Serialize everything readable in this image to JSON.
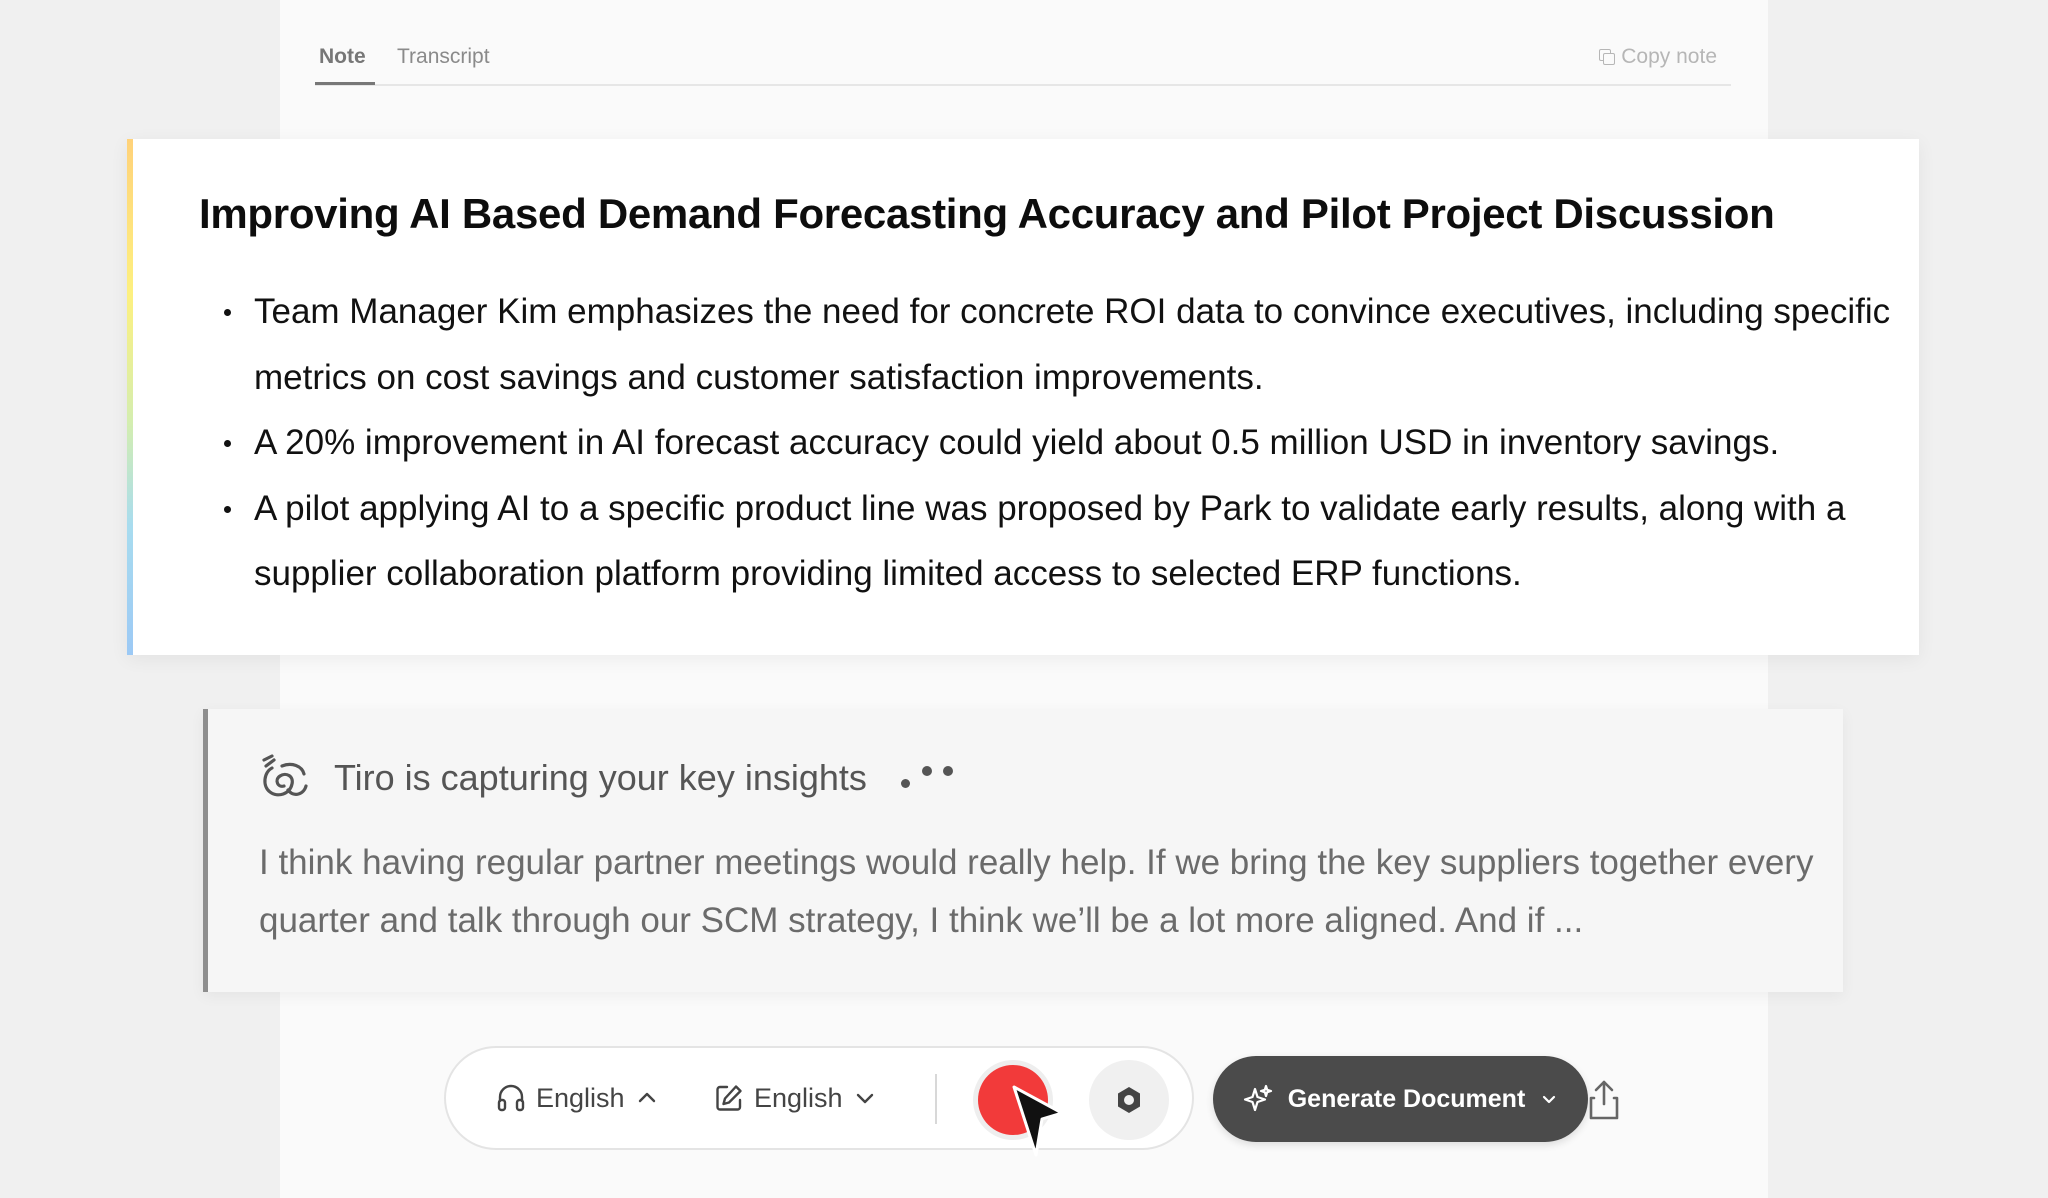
{
  "tabs": {
    "note": "Note",
    "transcript": "Transcript",
    "copy_note": "Copy note"
  },
  "summary": {
    "title": "Improving AI Based Demand Forecasting Accuracy and Pilot Project Discussion",
    "bullets": [
      "Team Manager Kim emphasizes the need for concrete ROI data to convince executives, including specific metrics on cost savings and customer satisfaction improvements.",
      "A 20% improvement in AI forecast accuracy could yield about 0.5 million USD in inventory savings.",
      "A pilot applying AI to a specific product line was proposed by Park to validate early results, along with a supplier collaboration platform providing limited access to selected ERP functions."
    ]
  },
  "capture": {
    "title": "Tiro is capturing your key insights",
    "text": "I think having regular partner meetings would really help. If we bring the key suppliers together every quarter and talk through our SCM strategy, I think we’ll be a lot more aligned. And if ..."
  },
  "toolbar": {
    "listen_language": "English",
    "write_language": "English",
    "generate_label": "Generate Document"
  },
  "colors": {
    "record": "#f23a3a",
    "generate_bg": "#4b4b4b",
    "capture_rule": "#8e8e8e"
  },
  "icons": {
    "listen": "headphones-icon",
    "write": "edit-icon",
    "settings": "hexagon-icon",
    "generate": "sparkles-icon",
    "share": "share-icon",
    "brand": "tiro-logo-icon"
  }
}
